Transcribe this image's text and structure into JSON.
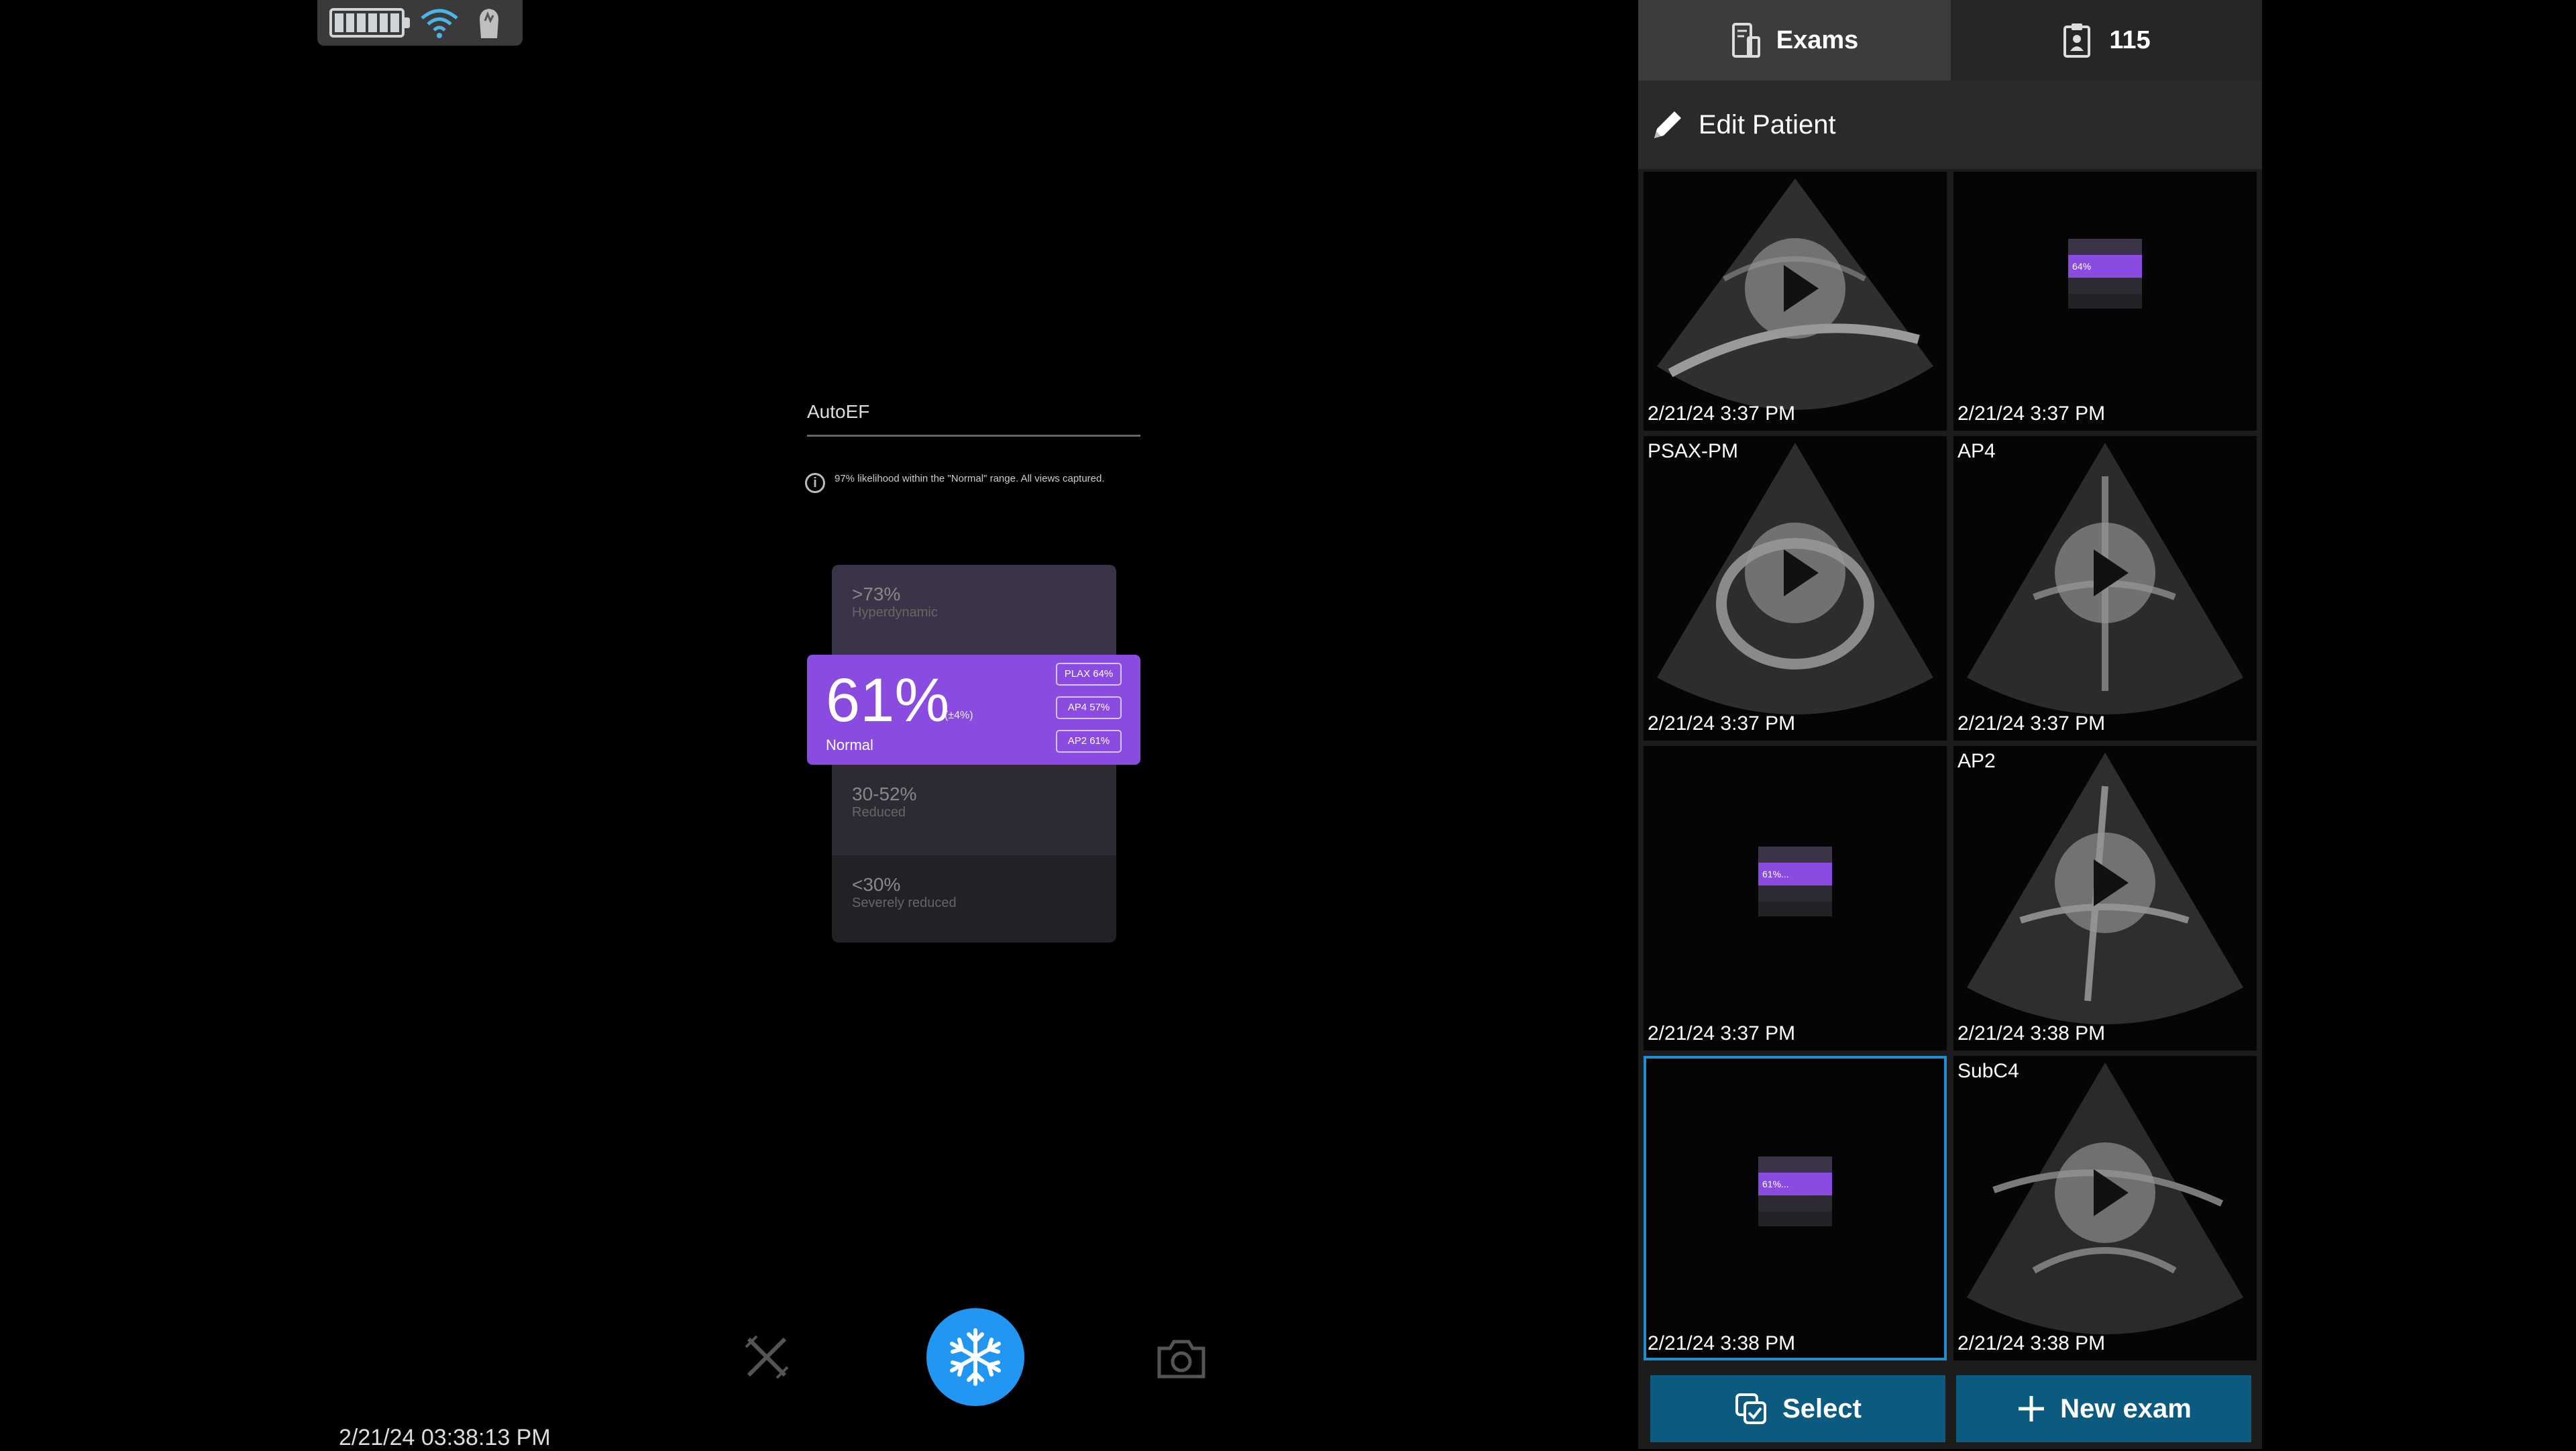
{
  "status_bar": {
    "battery_icon": "battery-full-icon",
    "wifi_icon": "wifi-icon",
    "probe_icon": "probe-icon"
  },
  "autoef": {
    "title": "AutoEF",
    "info": "97% likelihood within the \"Normal\" range. All views captured.",
    "tiles": {
      "hyper": {
        "range": ">73%",
        "label": "Hyperdynamic"
      },
      "reduced": {
        "range": "30-52%",
        "label": "Reduced"
      },
      "severe": {
        "range": "<30%",
        "label": "Severely reduced"
      }
    },
    "current": {
      "value": "61%",
      "delta": "(±4%)",
      "label": "Normal",
      "views": [
        "PLAX 64%",
        "AP4 57%",
        "AP2 61%"
      ]
    },
    "accent": "#8a4be0"
  },
  "toolbar": {
    "freeze_icon": "snowflake-icon",
    "camera_icon": "camera-icon",
    "cross_icon": "cross-tool-icon",
    "freeze_color": "#2196f3"
  },
  "timestamp": "2/21/24 03:38:13 PM",
  "panel": {
    "tabs": {
      "exams": "Exams",
      "count": "115"
    },
    "edit_patient": "Edit Patient",
    "thumbnails": [
      {
        "name": "",
        "date": "2/21/24 3:37 PM",
        "type": "clip"
      },
      {
        "name": "",
        "date": "2/21/24 3:37 PM",
        "type": "ef",
        "ef": "64%"
      },
      {
        "name": "PSAX-PM",
        "date": "2/21/24 3:37 PM",
        "type": "clip"
      },
      {
        "name": "AP4",
        "date": "2/21/24 3:37 PM",
        "type": "clip"
      },
      {
        "name": "",
        "date": "2/21/24 3:37 PM",
        "type": "ef",
        "ef": "61%..."
      },
      {
        "name": "AP2",
        "date": "2/21/24 3:38 PM",
        "type": "clip"
      },
      {
        "name": "",
        "date": "2/21/24 3:38 PM",
        "type": "ef",
        "ef": "61%...",
        "selected": true
      },
      {
        "name": "SubC4",
        "date": "2/21/24 3:38 PM",
        "type": "clip"
      }
    ],
    "select_label": "Select",
    "new_exam_label": "New exam",
    "button_color": "#0b5a80"
  }
}
